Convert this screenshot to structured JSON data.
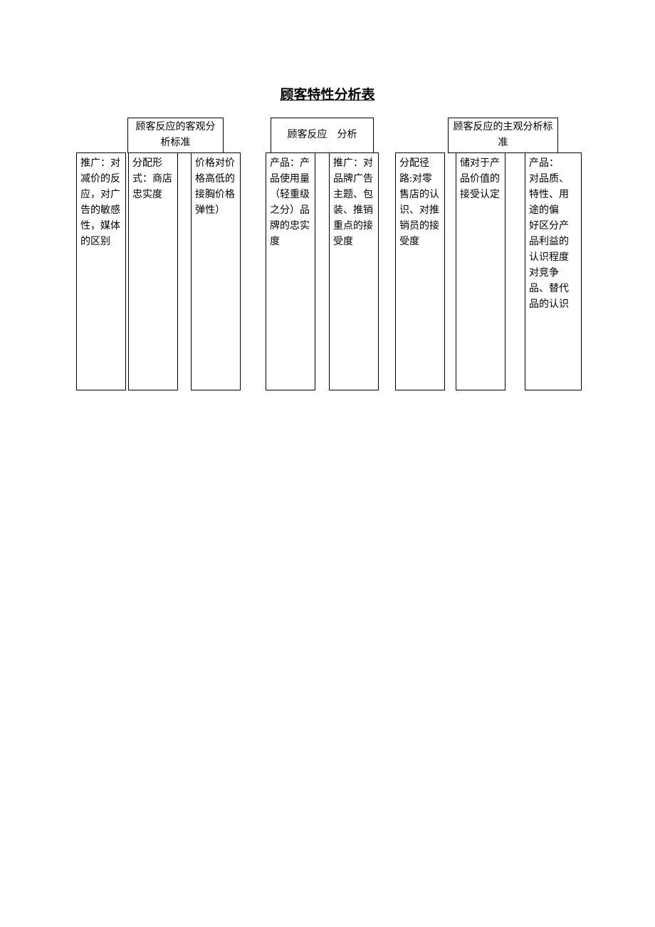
{
  "title": "顾客特性分析表",
  "headers": {
    "h1": "顾客反应的客观分析标准",
    "h2": "顾客反应　分析",
    "h3": "顾客反应的主观分析标准"
  },
  "columns": {
    "c1": "推广：对减价的反应，对广告的敏感性，媒体的区别",
    "c2": "分配形式：商店忠实度",
    "c3": "价格对价格高低的接胸价格弹性）",
    "c4": "产品：产品使用量（轻重级之分）品牌的忠实度",
    "c5": "推广：对品牌广告主题、包装、推销重点的接受度",
    "c6": "分配径路:对零售店的认识、对推销员的接受度",
    "c7": "储对于产品价值的接受认定",
    "c8": "产品：　　对品质、特性、用　途的偏　好区分产品利益的认识程度对竞争品、替代品的认识"
  }
}
